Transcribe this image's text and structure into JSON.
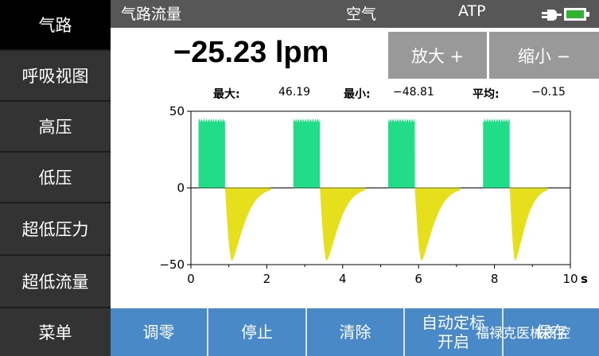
{
  "sidebar": {
    "items": [
      {
        "label": "气路",
        "active": true
      },
      {
        "label": "呼吸视图"
      },
      {
        "label": "高压"
      },
      {
        "label": "低压"
      },
      {
        "label": "超低压力"
      },
      {
        "label": "超低流量"
      },
      {
        "label": "菜单"
      }
    ]
  },
  "header": {
    "title": "气路流量",
    "gas": "空气",
    "mode": "ATP",
    "battery_icon": "plug-battery-icon"
  },
  "readout": {
    "value": "−25.23 lpm",
    "zoom_in": "放大 +",
    "zoom_out": "缩小 −",
    "max_label": "最大:",
    "max_value": "46.19",
    "min_label": "最小:",
    "min_value": "−48.81",
    "avg_label": "平均:",
    "avg_value": "−0.15"
  },
  "chart_data": {
    "type": "area",
    "x_unit": "s",
    "xlim": [
      0,
      10
    ],
    "ylim": [
      -50,
      50
    ],
    "x_ticks": [
      "0",
      "2",
      "4",
      "6",
      "8",
      "10"
    ],
    "y_ticks": [
      "50",
      "0",
      "−50"
    ],
    "series": [
      {
        "role": "inhale",
        "color": "#22dd88",
        "segments": [
          [
            0.2,
            0.9
          ],
          [
            2.7,
            3.4
          ],
          [
            5.2,
            5.9
          ],
          [
            7.7,
            8.4
          ]
        ],
        "level": 44
      },
      {
        "role": "exhale",
        "color": "#e6e01c",
        "segments": [
          [
            0.9,
            2.1
          ],
          [
            3.4,
            4.6
          ],
          [
            5.9,
            7.1
          ],
          [
            8.4,
            9.4
          ]
        ],
        "peak": -47.5
      }
    ]
  },
  "toolbar": {
    "zero": "调零",
    "stop": "停止",
    "clear": "清除",
    "autocal": "自动定标\n开启",
    "save": "保存"
  },
  "watermark": "福禄克医械质控"
}
